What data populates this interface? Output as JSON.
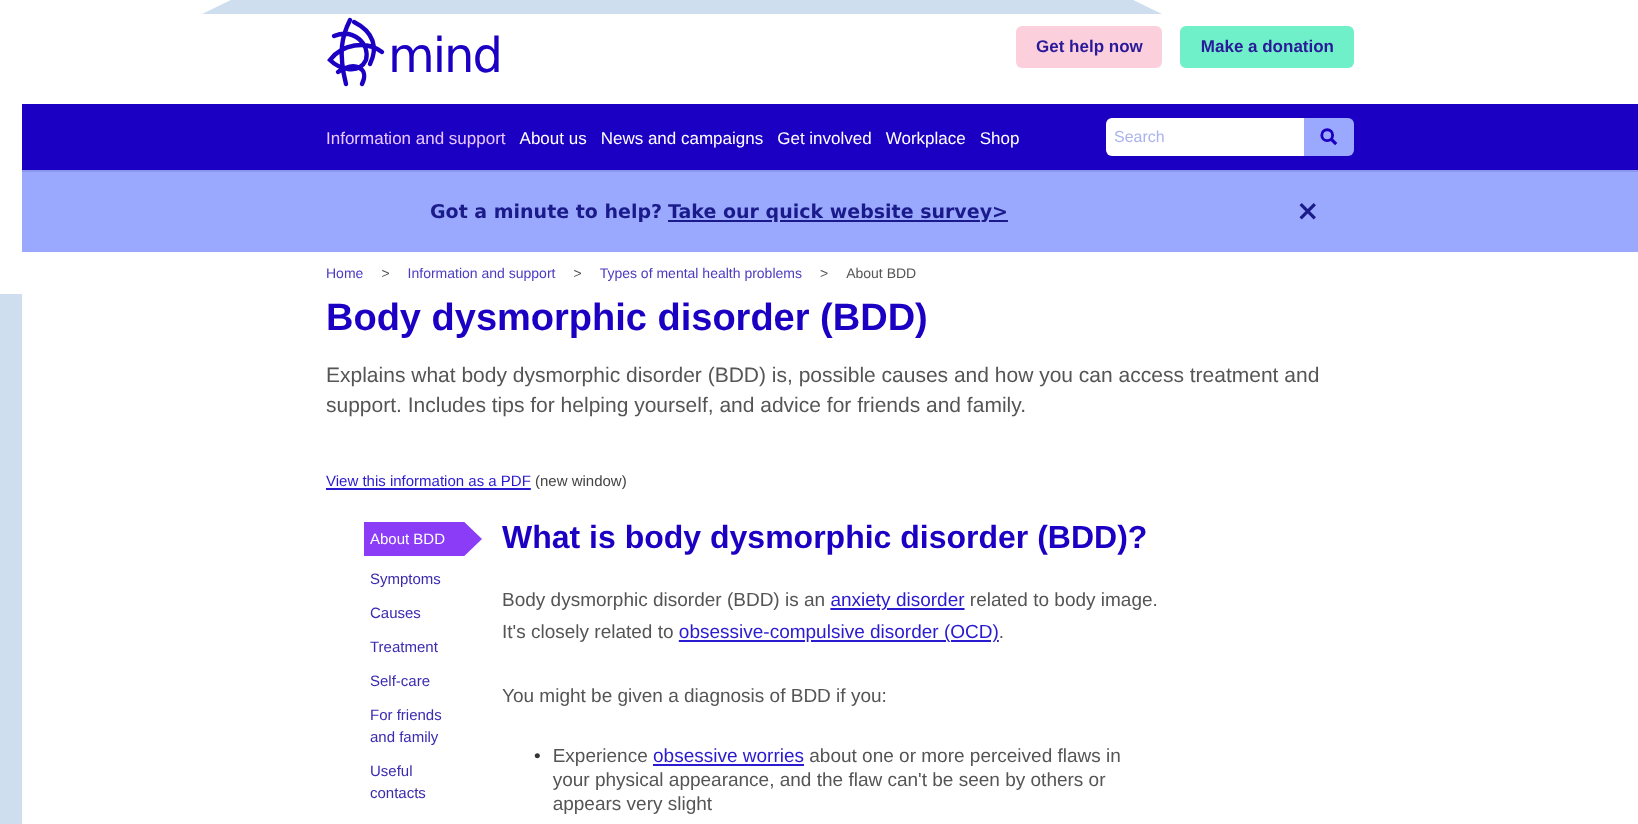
{
  "header": {
    "logo_text": "mind",
    "buttons": [
      {
        "label": "Get help now",
        "kind": "help"
      },
      {
        "label": "Make a donation",
        "kind": "donate"
      }
    ]
  },
  "nav": {
    "items": [
      {
        "label": "Information and support",
        "selected": true
      },
      {
        "label": "About us",
        "selected": false
      },
      {
        "label": "News and campaigns",
        "selected": false
      },
      {
        "label": "Get involved",
        "selected": false
      },
      {
        "label": "Workplace",
        "selected": false
      },
      {
        "label": "Shop",
        "selected": false
      }
    ],
    "search": {
      "placeholder": "Search"
    }
  },
  "survey_banner": {
    "text": "Got a minute to help?",
    "link": "Take our quick website survey>",
    "close": "×"
  },
  "breadcrumb": [
    {
      "label": "Home",
      "current": false
    },
    {
      "label": "Information and support",
      "current": false
    },
    {
      "label": "Types of mental health problems",
      "current": false
    },
    {
      "label": "About BDD",
      "current": true
    }
  ],
  "breadcrumb_separator": ">",
  "title": "Body dysmorphic disorder (BDD)",
  "description": "Explains what body dysmorphic disorder (BDD) is, possible causes and how you can access treatment and support. Includes tips for helping yourself, and advice for friends and family.",
  "pdf": {
    "link": "View this information as a PDF",
    "note": "(new window)"
  },
  "sidebar": [
    {
      "label": "About BDD",
      "selected": true
    },
    {
      "label": "Symptoms",
      "selected": false
    },
    {
      "label": "Causes",
      "selected": false
    },
    {
      "label": "Treatment",
      "selected": false
    },
    {
      "label": "Self-care",
      "selected": false
    },
    {
      "label": "For friends and family",
      "selected": false
    },
    {
      "label": "Useful contacts",
      "selected": false
    }
  ],
  "article": {
    "heading": "What is body dysmorphic disorder (BDD)?",
    "blocks": [
      {
        "kind": "paragraph",
        "parts": [
          {
            "kind": "text",
            "text": "Body dysmorphic disorder (BDD) is an "
          },
          {
            "kind": "link",
            "text": "anxiety disorder"
          },
          {
            "kind": "text",
            "text": " related to body image. It's closely related to "
          },
          {
            "kind": "link",
            "text": "obsessive-compulsive disorder (OCD)"
          },
          {
            "kind": "text",
            "text": "."
          }
        ]
      },
      {
        "kind": "paragraph",
        "parts": [
          {
            "kind": "text",
            "text": "You might be given a diagnosis of BDD if you:"
          }
        ]
      },
      {
        "kind": "bullet",
        "marker": "•",
        "parts": [
          {
            "kind": "text",
            "text": "Experience "
          },
          {
            "kind": "link",
            "text": "obsessive worries"
          },
          {
            "kind": "text",
            "text": " about one or more perceived flaws in your physical appearance, and the flaw can't be seen by others or appears very slight"
          }
        ]
      }
    ]
  }
}
